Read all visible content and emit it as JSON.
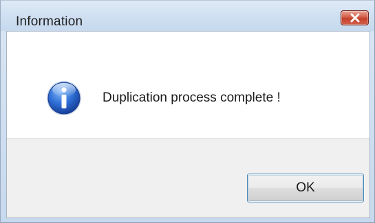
{
  "window": {
    "title": "Information"
  },
  "dialog": {
    "icon": "information-icon",
    "message": "Duplication process complete !",
    "ok_label": "OK"
  },
  "colors": {
    "close_button": "#c7432e",
    "ok_border": "#3c7fb1",
    "info_icon": "#2a6ad0"
  }
}
